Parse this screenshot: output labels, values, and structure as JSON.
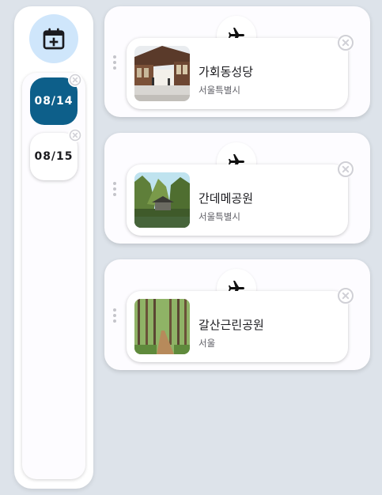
{
  "sidebar": {
    "add_button_icon": "calendar-add-icon",
    "dates": [
      {
        "label": "08/14",
        "active": true
      },
      {
        "label": "08/15",
        "active": false
      }
    ]
  },
  "places": [
    {
      "name": "가회동성당",
      "region": "서울특별시",
      "icon": "airplane-icon",
      "thumb": "courtyard-hanok-photo"
    },
    {
      "name": "간데메공원",
      "region": "서울특별시",
      "icon": "airplane-icon",
      "thumb": "pavilion-cliff-photo"
    },
    {
      "name": "갈산근린공원",
      "region": "서울",
      "icon": "airplane-icon",
      "thumb": "forest-path-photo"
    }
  ],
  "colors": {
    "background": "#dde3ea",
    "active_date": "#0d5f8a",
    "add_button_bg": "#cfe6fb"
  }
}
